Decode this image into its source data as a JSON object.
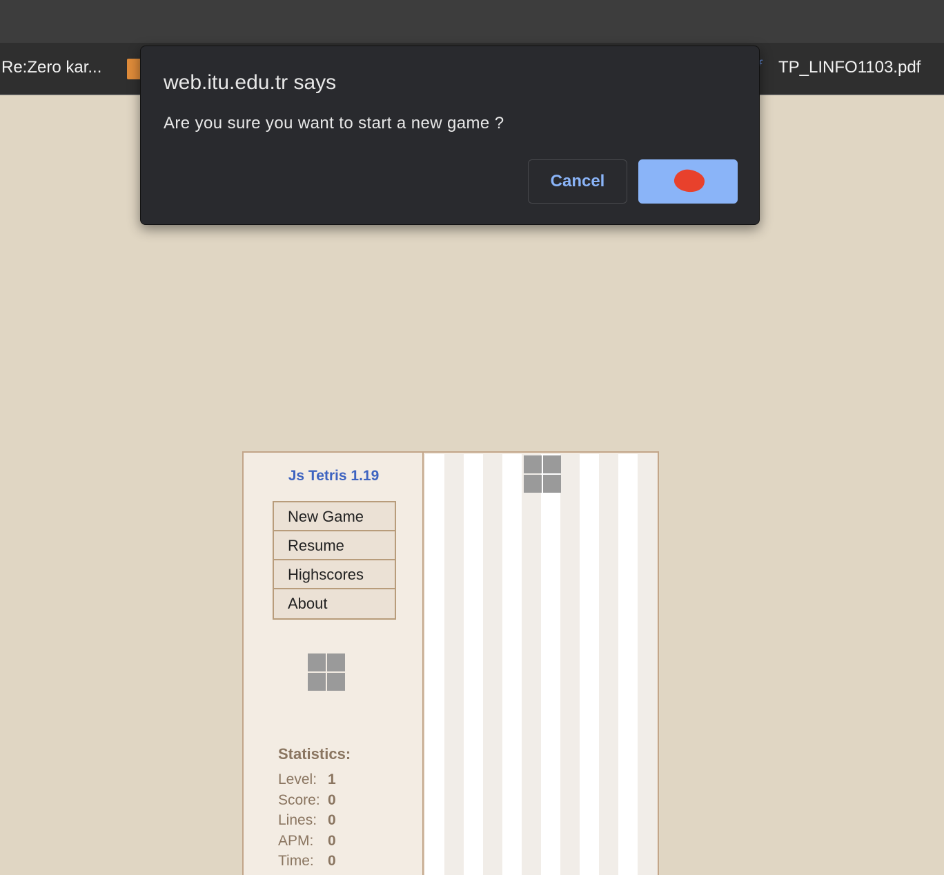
{
  "browser": {
    "bookmarks": {
      "left_label": "Re:Zero kar...",
      "right_label": "TP_LINFO1103.pdf",
      "right_icon": "pdf-file-icon",
      "left_icon": "music-favicon-icon"
    }
  },
  "dialog": {
    "title": "web.itu.edu.tr says",
    "message": "Are you sure you want to start a new game ?",
    "cancel_label": "Cancel",
    "ok_label": "OK",
    "accent": "#8ab4f8"
  },
  "game": {
    "title": "Js Tetris 1.19",
    "menu": [
      "New Game",
      "Resume",
      "Highscores",
      "About"
    ],
    "next_piece": "O",
    "stats_title": "Statistics:",
    "stats": [
      {
        "label": "Level:",
        "value": "1"
      },
      {
        "label": "Score:",
        "value": "0"
      },
      {
        "label": "Lines:",
        "value": "0"
      },
      {
        "label": "APM:",
        "value": "0"
      },
      {
        "label": "Time:",
        "value": "0"
      }
    ]
  }
}
